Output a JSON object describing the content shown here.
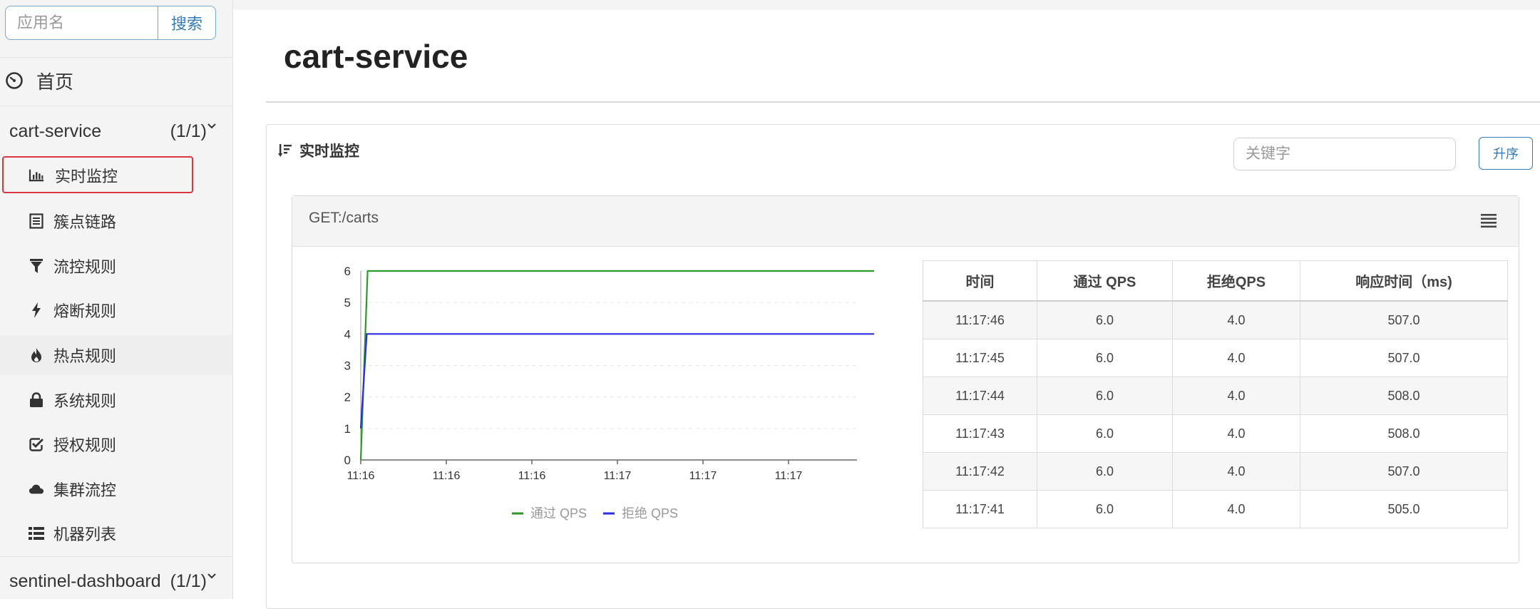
{
  "sidebar": {
    "search_placeholder": "应用名",
    "search_button": "搜索",
    "home_label": "首页",
    "apps": [
      {
        "name": "cart-service",
        "count": "(1/1)"
      },
      {
        "name": "sentinel-dashboard",
        "count": "(1/1)"
      }
    ],
    "menu": [
      {
        "label": "实时监控",
        "icon": "bar-chart-icon"
      },
      {
        "label": "簇点链路",
        "icon": "list-alt-icon"
      },
      {
        "label": "流控规则",
        "icon": "filter-icon"
      },
      {
        "label": "熔断规则",
        "icon": "flash-icon"
      },
      {
        "label": "热点规则",
        "icon": "fire-icon"
      },
      {
        "label": "系统规则",
        "icon": "lock-icon"
      },
      {
        "label": "授权规则",
        "icon": "check-icon"
      },
      {
        "label": "集群流控",
        "icon": "cloud-icon"
      },
      {
        "label": "机器列表",
        "icon": "th-list-icon"
      }
    ]
  },
  "main": {
    "page_title": "cart-service",
    "panel_title": "实时监控",
    "keyword_placeholder": "关键字",
    "sort_button": "升序",
    "resource_title": "GET:/carts",
    "legend": {
      "pass": "通过 QPS",
      "block": "拒绝 QPS"
    },
    "table": {
      "headers": [
        "时间",
        "通过 QPS",
        "拒绝QPS",
        "响应时间（ms)"
      ],
      "rows": [
        [
          "11:17:46",
          "6.0",
          "4.0",
          "507.0"
        ],
        [
          "11:17:45",
          "6.0",
          "4.0",
          "507.0"
        ],
        [
          "11:17:44",
          "6.0",
          "4.0",
          "508.0"
        ],
        [
          "11:17:43",
          "6.0",
          "4.0",
          "508.0"
        ],
        [
          "11:17:42",
          "6.0",
          "4.0",
          "507.0"
        ],
        [
          "11:17:41",
          "6.0",
          "4.0",
          "505.0"
        ]
      ]
    }
  },
  "colors": {
    "pass": "#2a9a2a",
    "block": "#2d2de6",
    "accent": "#337ab7",
    "highlight": "#d9363e"
  },
  "chart_data": {
    "type": "line",
    "x_tick_labels": [
      "11:16",
      "11:16",
      "11:16",
      "11:17",
      "11:17",
      "11:17"
    ],
    "ylim": [
      0,
      6
    ],
    "y_ticks": [
      0,
      1,
      2,
      3,
      4,
      5,
      6
    ],
    "grid": true,
    "legend_position": "bottom",
    "series": [
      {
        "name": "通过 QPS",
        "points": [
          [
            0,
            0
          ],
          [
            0.08,
            6
          ],
          [
            6,
            6
          ]
        ]
      },
      {
        "name": "拒绝 QPS",
        "points": [
          [
            0,
            1
          ],
          [
            0.07,
            4
          ],
          [
            6,
            4
          ]
        ]
      }
    ]
  }
}
